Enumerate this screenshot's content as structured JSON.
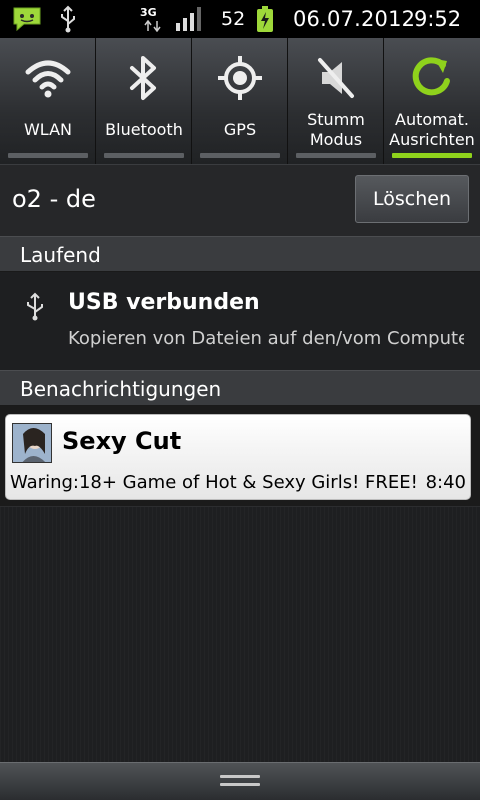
{
  "status_bar": {
    "network_type": "3G",
    "battery_level": "52",
    "date": "06.07.2012",
    "time": "9:52"
  },
  "quick_settings": [
    {
      "label": "WLAN",
      "icon": "wifi-icon",
      "active": false
    },
    {
      "label": "Bluetooth",
      "icon": "bluetooth-icon",
      "active": false
    },
    {
      "label": "GPS",
      "icon": "gps-icon",
      "active": false
    },
    {
      "label": "Stumm\nModus",
      "icon": "mute-icon",
      "active": false
    },
    {
      "label": "Automat.\nAusrichten",
      "icon": "rotate-icon",
      "active": true
    }
  ],
  "carrier": {
    "name": "o2 - de",
    "clear_label": "Löschen"
  },
  "ongoing": {
    "header": "Laufend",
    "title": "USB verbunden",
    "text": "Kopieren von Dateien auf den/vom Computer"
  },
  "notifications": {
    "header": "Benachrichtigungen",
    "items": [
      {
        "title": "Sexy Cut",
        "text": "Waring:18+ Game of Hot & Sexy Girls! FREE!",
        "time": "8:40"
      }
    ]
  },
  "colors": {
    "accent_green": "#8fd21c",
    "indicator_off": "#5c5f63"
  }
}
